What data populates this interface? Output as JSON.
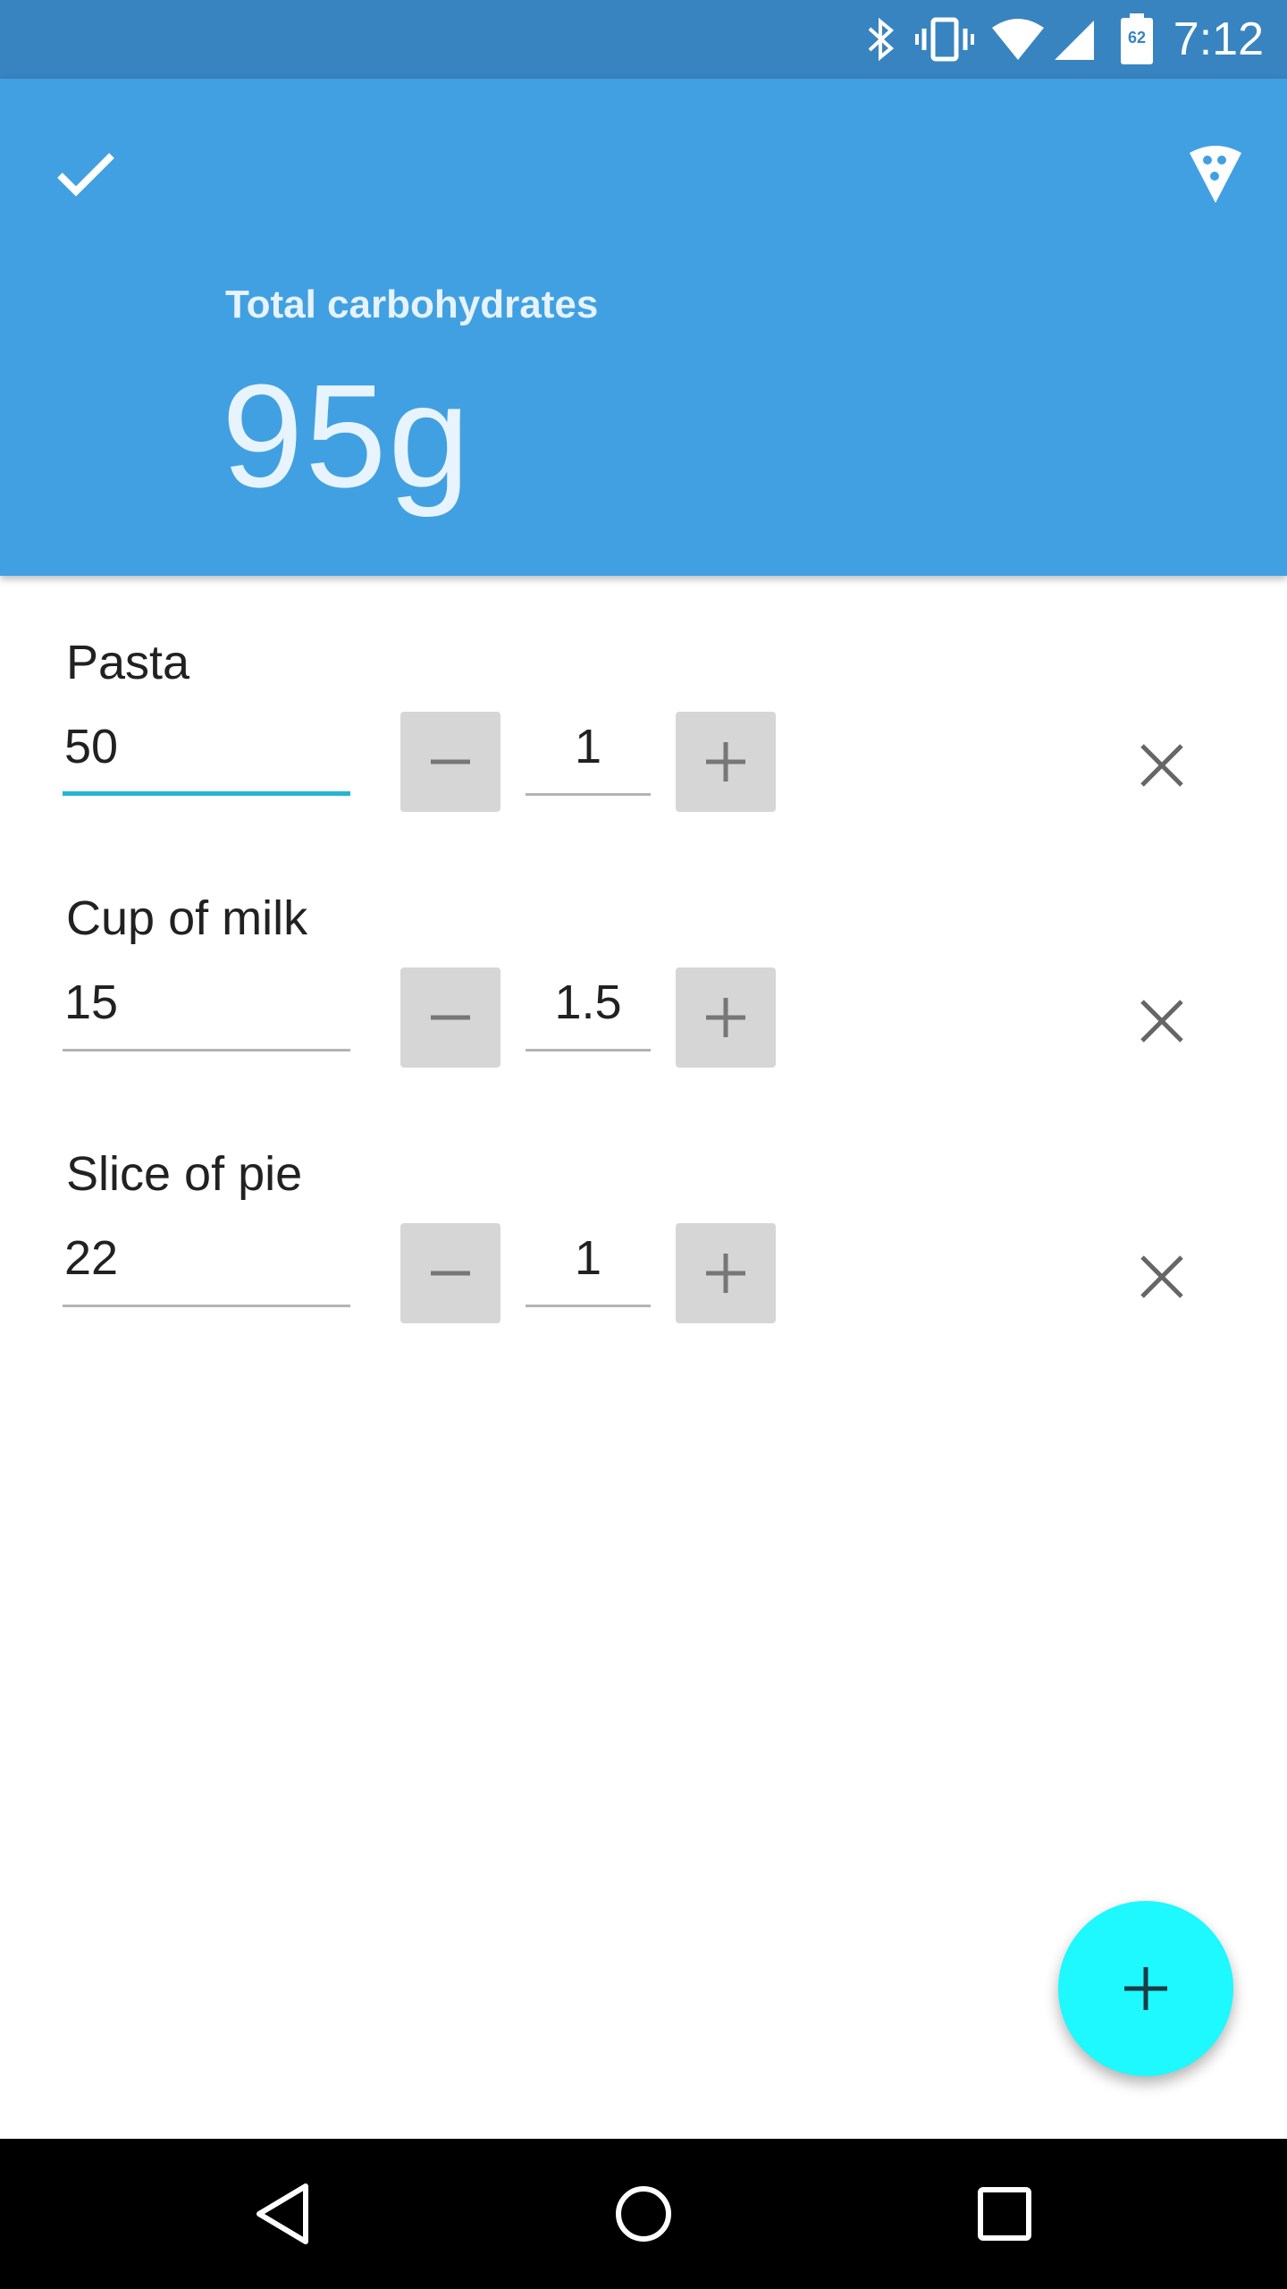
{
  "status_bar": {
    "time": "7:12",
    "battery_level": "62",
    "icons": [
      "bluetooth-icon",
      "vibrate-icon",
      "wifi-icon",
      "cell-signal-icon",
      "battery-icon"
    ]
  },
  "header": {
    "confirm_icon": "check-icon",
    "food_icon": "pizza-slice-icon",
    "total_label": "Total carbohydrates",
    "total_value": "95g",
    "color": "#41a0e2"
  },
  "items": [
    {
      "name": "Pasta",
      "carbs": "50",
      "quantity": "1",
      "active": true
    },
    {
      "name": "Cup of milk",
      "carbs": "15",
      "quantity": "1.5",
      "active": false
    },
    {
      "name": "Slice of pie",
      "carbs": "22",
      "quantity": "1",
      "active": false
    }
  ],
  "fab": {
    "icon": "plus-icon",
    "color": "#1ef8ff"
  },
  "nav": {
    "icons": [
      "back-icon",
      "home-icon",
      "recents-icon"
    ]
  }
}
